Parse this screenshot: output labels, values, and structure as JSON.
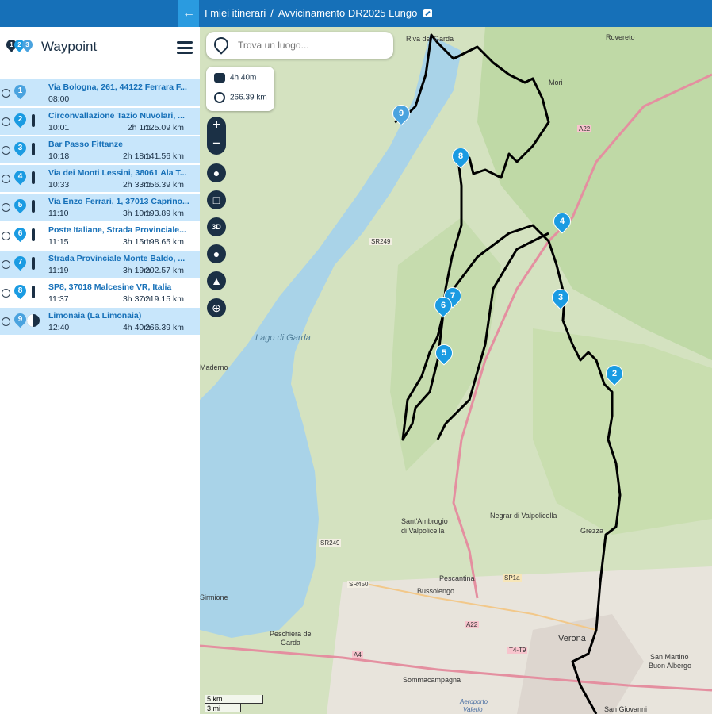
{
  "breadcrumb": {
    "root": "I miei itinerari",
    "separator": "/",
    "current": "Avvicinamento DR2025 Lungo"
  },
  "sidebar": {
    "title": "Waypoint",
    "logo_numbers": [
      "1",
      "2",
      "3"
    ]
  },
  "waypoints": [
    {
      "num": "1",
      "name": "Via Bologna, 261, 44122 Ferrara F...",
      "time": "08:00",
      "duration": "",
      "distance": ""
    },
    {
      "num": "2",
      "name": "Circonvallazione Tazio Nuvolari, ...",
      "time": "10:01",
      "duration": "2h 1m",
      "distance": "125.09 km"
    },
    {
      "num": "3",
      "name": "Bar Passo Fittanze",
      "time": "10:18",
      "duration": "2h 18m",
      "distance": "141.56 km"
    },
    {
      "num": "4",
      "name": "Via dei Monti Lessini, 38061 Ala T...",
      "time": "10:33",
      "duration": "2h 33m",
      "distance": "156.39 km"
    },
    {
      "num": "5",
      "name": "Via Enzo Ferrari, 1, 37013 Caprino...",
      "time": "11:10",
      "duration": "3h 10m",
      "distance": "193.89 km"
    },
    {
      "num": "6",
      "name": "Poste Italiane, Strada Provinciale...",
      "time": "11:15",
      "duration": "3h 15m",
      "distance": "198.65 km"
    },
    {
      "num": "7",
      "name": "Strada Provinciale Monte Baldo, ...",
      "time": "11:19",
      "duration": "3h 19m",
      "distance": "202.57 km"
    },
    {
      "num": "8",
      "name": "SP8, 37018 Malcesine VR, Italia",
      "time": "11:37",
      "duration": "3h 37m",
      "distance": "219.15 km"
    },
    {
      "num": "9",
      "name": "Limonaia (La Limonaia)",
      "time": "12:40",
      "duration": "4h 40m",
      "distance": "266.39 km"
    }
  ],
  "search": {
    "placeholder": "Trova un luogo..."
  },
  "route_stats": {
    "duration": "4h 40m",
    "distance": "266.39 km"
  },
  "map_controls": {
    "zoom_in": "+",
    "zoom_out": "−",
    "three_d": "3D"
  },
  "map_labels": {
    "riva": "Riva del Garda",
    "rovereto": "Rovereto",
    "mori": "Mori",
    "a22_1": "A22",
    "sr249_1": "SR249",
    "lago": "Lago di Garda",
    "maderno": "Maderno",
    "santambrogio": "Sant'Ambrogio",
    "valpolicella": "di Valpolicella",
    "negrar": "Negrar di Valpolicella",
    "grezzana": "Grezza",
    "sr249_2": "SR249",
    "sr450": "SR450",
    "pescantina": "Pescantina",
    "sp1a": "SP1a",
    "bussolengo": "Bussolengo",
    "a22_2": "A22",
    "sirmione": "Sirmione",
    "peschiera": "Peschiera del",
    "garda": "Garda",
    "a4": "A4",
    "verona": "Verona",
    "t4t9": "T4-T9",
    "sanmartino": "San Martino",
    "buonalbergo": "Buon Albergo",
    "sommacampagna": "Sommacampagna",
    "aeroporto": "Aeroporto",
    "valerio": "Valerio",
    "sangiovanni": "San Giovanni"
  },
  "map_markers": [
    "2",
    "3",
    "4",
    "5",
    "6",
    "7",
    "8",
    "9"
  ],
  "scale": {
    "km": "5 km",
    "mi": "3 mi"
  },
  "colors": {
    "topbar": "#1670b8",
    "row_bg": "#c8e6fb",
    "pin": "#1a9be2",
    "dark": "#1b3045",
    "route": "#000000",
    "lake": "#a9d3e8"
  }
}
